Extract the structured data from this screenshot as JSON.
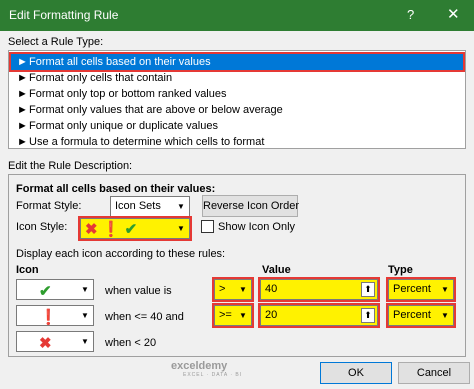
{
  "window": {
    "title": "Edit Formatting Rule",
    "help_label": "?",
    "close_label": "✕"
  },
  "rule_type": {
    "heading": "Select a Rule Type:",
    "items": [
      "Format all cells based on their values",
      "Format only cells that contain",
      "Format only top or bottom ranked values",
      "Format only values that are above or below average",
      "Format only unique or duplicate values",
      "Use a formula to determine which cells to format"
    ]
  },
  "description": {
    "heading": "Edit the Rule Description:",
    "subheading": "Format all cells based on their values:",
    "format_style_label": "Format Style:",
    "format_style_value": "Icon Sets",
    "reverse_button": "Reverse Icon Order",
    "icon_style_label": "Icon Style:",
    "show_icon_only_label": "Show Icon Only",
    "display_label": "Display each icon according to these rules:",
    "col_icon": "Icon",
    "col_value": "Value",
    "col_type": "Type"
  },
  "rules": [
    {
      "icon": "check-icon",
      "text": "when value is",
      "operator": ">",
      "value": "40",
      "type": "Percent"
    },
    {
      "icon": "exclamation-icon",
      "text": "when <= 40 and",
      "operator": ">=",
      "value": "20",
      "type": "Percent"
    },
    {
      "icon": "cross-icon",
      "text": "when < 20"
    }
  ],
  "watermark": {
    "brand": "exceldemy",
    "tagline": "EXCEL · DATA · BI"
  },
  "footer": {
    "ok_label": "OK",
    "cancel_label": "Cancel"
  },
  "colors": {
    "title_bar": "#2e7d32",
    "selection": "#0078d7",
    "highlight": "#fff200",
    "annotation": "#e53935"
  }
}
